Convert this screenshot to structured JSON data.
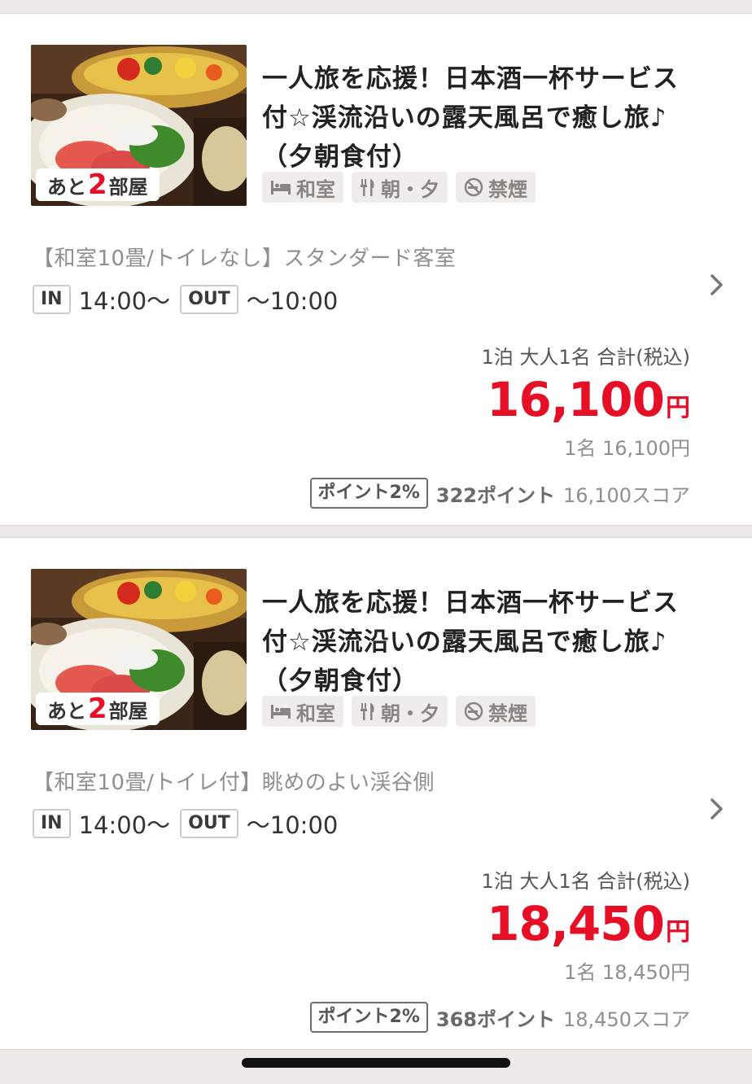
{
  "plans": [
    {
      "rooms_prefix": "あと",
      "rooms_count": "2",
      "rooms_suffix": "部屋",
      "title": "一人旅を応援！日本酒一杯サービス付☆渓流沿いの露天風呂で癒し旅♪（夕朝食付）",
      "tags": [
        {
          "icon": "bed-icon",
          "label": "和室"
        },
        {
          "icon": "fork-knife-icon",
          "label": "朝・夕"
        },
        {
          "icon": "no-smoking-icon",
          "label": "禁煙"
        }
      ],
      "room_name": "【和室10畳/トイレなし】スタンダード客室",
      "checkin_label": "IN",
      "checkin_time": "14:00〜",
      "checkout_label": "OUT",
      "checkout_time": "〜10:00",
      "price_condition": "1泊 大人1名 合計(税込)",
      "price": "16,100",
      "price_unit": "円",
      "per_person": "1名 16,100円",
      "point_rate": "ポイント2%",
      "points": "322ポイント",
      "score": "16,100スコア"
    },
    {
      "rooms_prefix": "あと",
      "rooms_count": "2",
      "rooms_suffix": "部屋",
      "title": "一人旅を応援！日本酒一杯サービス付☆渓流沿いの露天風呂で癒し旅♪（夕朝食付）",
      "tags": [
        {
          "icon": "bed-icon",
          "label": "和室"
        },
        {
          "icon": "fork-knife-icon",
          "label": "朝・夕"
        },
        {
          "icon": "no-smoking-icon",
          "label": "禁煙"
        }
      ],
      "room_name": "【和室10畳/トイレ付】眺めのよい渓谷側",
      "checkin_label": "IN",
      "checkin_time": "14:00〜",
      "checkout_label": "OUT",
      "checkout_time": "〜10:00",
      "price_condition": "1泊 大人1名 合計(税込)",
      "price": "18,450",
      "price_unit": "円",
      "per_person": "1名 18,450円",
      "point_rate": "ポイント2%",
      "points": "368ポイント",
      "score": "18,450スコア"
    }
  ],
  "colors": {
    "accent_red": "#e60f26",
    "tag_bg": "#efedeb",
    "page_bg": "#ece9e6"
  }
}
